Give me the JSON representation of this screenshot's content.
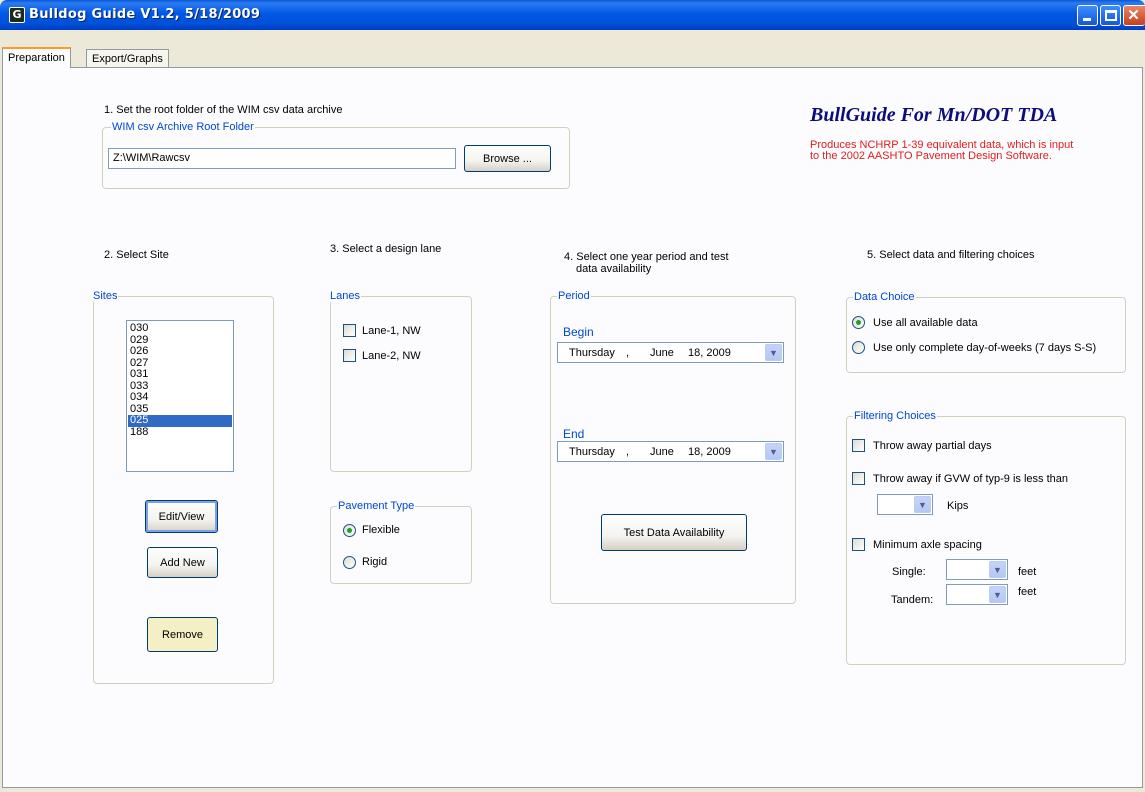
{
  "window": {
    "title": "Bulldog Guide V1.2, 5/18/2009",
    "app_icon": "G"
  },
  "tabs": [
    {
      "label": "Preparation"
    },
    {
      "label": "Export/Graphs"
    }
  ],
  "step1": {
    "label": "1. Set the root folder of the WIM csv data archive",
    "group_label": "WIM csv Archive Root Folder",
    "folder_value": "Z:\\WIM\\Rawcsv",
    "browse_label": "Browse ..."
  },
  "banner": {
    "title": "BullGuide For Mn/DOT TDA",
    "note_line1": "Produces NCHRP 1-39 equivalent data, which is input",
    "note_line2": "to the 2002 AASHTO Pavement Design Software."
  },
  "step2": {
    "label": "2. Select Site",
    "group_label": "Sites",
    "sites": [
      "030",
      "029",
      "026",
      "027",
      "031",
      "033",
      "034",
      "035",
      "025",
      "188"
    ],
    "selected_site": "025",
    "edit_label": "Edit/View",
    "add_label": "Add New",
    "remove_label": "Remove"
  },
  "step3": {
    "label": "3. Select a design lane",
    "lanes_group": "Lanes",
    "lanes": [
      {
        "label": "Lane-1, NW",
        "checked": false
      },
      {
        "label": "Lane-2, NW",
        "checked": false
      }
    ],
    "pavement_group": "Pavement Type",
    "pavement_options": [
      {
        "label": "Flexible",
        "selected": true
      },
      {
        "label": "Rigid",
        "selected": false
      }
    ]
  },
  "step4": {
    "label_line1": "4. Select one year period and test",
    "label_line2": "data availability",
    "group_label": "Period",
    "begin_label": "Begin",
    "begin": {
      "weekday": "Thursday",
      "sep": ",",
      "month": "June",
      "day_year": "18, 2009"
    },
    "end_label": "End",
    "end": {
      "weekday": "Thursday",
      "sep": ",",
      "month": "June",
      "day_year": "18, 2009"
    },
    "test_label": "Test Data Availability"
  },
  "step5": {
    "label": "5. Select data and filtering choices",
    "data_group": "Data Choice",
    "data_options": [
      {
        "label": "Use all available data",
        "selected": true
      },
      {
        "label": "Use only complete day-of-weeks (7 days S-S)",
        "selected": false
      }
    ],
    "filter_group": "Filtering Choices",
    "throw_partial": "Throw away partial days",
    "throw_gvw": "Throw away if GVW of typ-9 is less than",
    "kips_label": "Kips",
    "min_axle": "Minimum axle spacing",
    "single_label": "Single:",
    "tandem_label": "Tandem:",
    "feet_label": "feet"
  },
  "icons": {
    "minimize": "minimize-icon",
    "maximize": "maximize-icon",
    "close": "close-icon",
    "dropdown": "chevron-down-icon"
  },
  "colors": {
    "titlebar": "#0058e6",
    "selection": "#316ac5",
    "banner_title": "#0c0c7e",
    "note": "#e02020",
    "remove_button": "#f4efc4"
  }
}
